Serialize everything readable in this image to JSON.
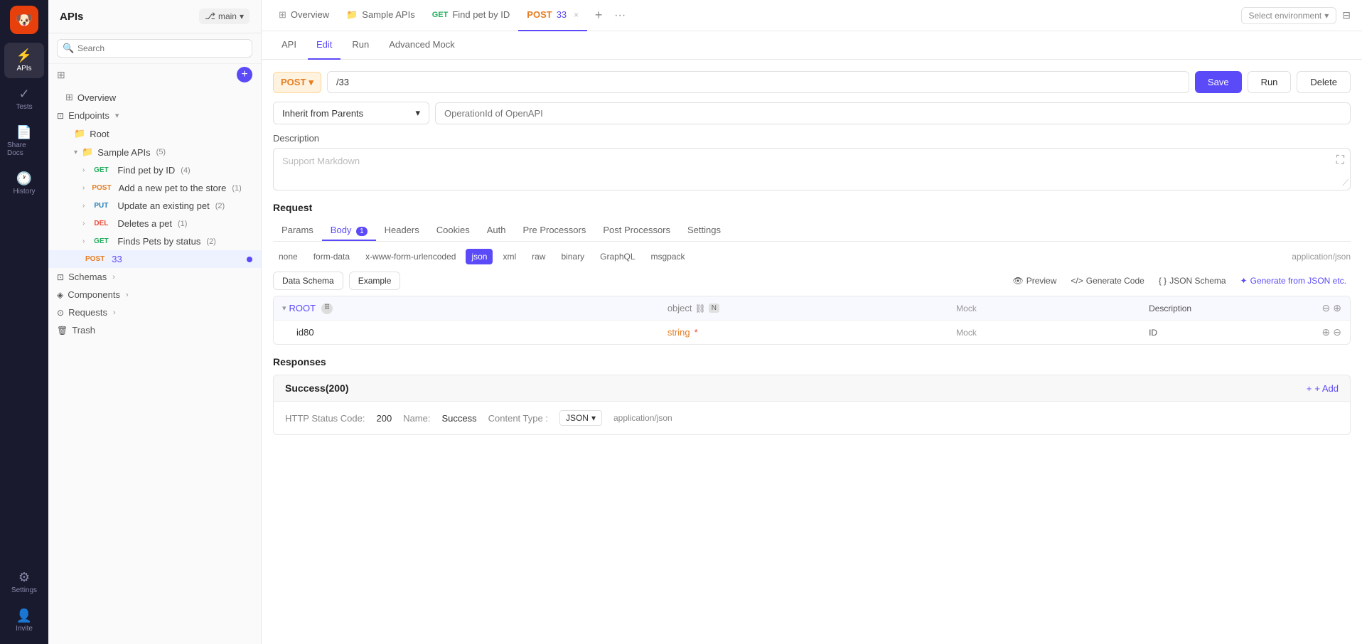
{
  "app": {
    "title": "APIs",
    "branch": "main"
  },
  "iconBar": {
    "items": [
      {
        "id": "apis",
        "label": "APIs",
        "icon": "⚡",
        "active": true
      },
      {
        "id": "tests",
        "label": "Tests",
        "icon": "🧪",
        "active": false
      },
      {
        "id": "share-docs",
        "label": "Share Docs",
        "icon": "📄",
        "active": false
      },
      {
        "id": "history",
        "label": "History",
        "icon": "🕐",
        "active": false
      },
      {
        "id": "settings",
        "label": "Settings",
        "icon": "⚙️",
        "active": false
      },
      {
        "id": "invite",
        "label": "Invite",
        "icon": "👤",
        "active": false
      }
    ]
  },
  "sidebar": {
    "search_placeholder": "Search",
    "items": [
      {
        "id": "overview",
        "label": "Overview",
        "type": "overview",
        "depth": 0
      },
      {
        "id": "endpoints",
        "label": "Endpoints",
        "type": "section",
        "depth": 0
      },
      {
        "id": "root",
        "label": "Root",
        "type": "folder",
        "depth": 1
      },
      {
        "id": "sample-apis",
        "label": "Sample APIs",
        "count": "(5)",
        "type": "folder-expanded",
        "depth": 1
      },
      {
        "id": "find-pet",
        "label": "Find pet by ID",
        "method": "GET",
        "count": "(4)",
        "type": "endpoint",
        "depth": 2
      },
      {
        "id": "add-pet",
        "label": "Add a new pet to the store",
        "method": "POST",
        "count": "(1)",
        "type": "endpoint",
        "depth": 2
      },
      {
        "id": "update-pet",
        "label": "Update an existing pet",
        "method": "PUT",
        "count": "(2)",
        "type": "endpoint",
        "depth": 2
      },
      {
        "id": "delete-pet",
        "label": "Deletes a pet",
        "method": "DEL",
        "count": "(1)",
        "type": "endpoint",
        "depth": 2
      },
      {
        "id": "finds-pets",
        "label": "Finds Pets by status",
        "method": "GET",
        "count": "(2)",
        "type": "endpoint",
        "depth": 2
      },
      {
        "id": "post33",
        "label": "33",
        "method": "POST",
        "type": "endpoint",
        "depth": 2,
        "active": true
      },
      {
        "id": "schemas",
        "label": "Schemas",
        "type": "section",
        "depth": 0
      },
      {
        "id": "components",
        "label": "Components",
        "type": "section",
        "depth": 0
      },
      {
        "id": "requests",
        "label": "Requests",
        "type": "section",
        "depth": 0
      },
      {
        "id": "trash",
        "label": "Trash",
        "type": "section",
        "depth": 0
      }
    ]
  },
  "topTabs": {
    "items": [
      {
        "id": "overview",
        "label": "Overview",
        "icon": "⊞",
        "active": false
      },
      {
        "id": "sample-apis",
        "label": "Sample APIs",
        "icon": "📁",
        "active": false
      },
      {
        "id": "find-pet-get",
        "label": "Find pet by ID",
        "method": "GET",
        "active": false
      },
      {
        "id": "post33",
        "label": "33",
        "method": "POST",
        "active": true
      }
    ],
    "env_placeholder": "Select environment"
  },
  "subTabs": {
    "items": [
      {
        "id": "api",
        "label": "API",
        "active": false
      },
      {
        "id": "edit",
        "label": "Edit",
        "active": true
      },
      {
        "id": "run",
        "label": "Run",
        "active": false
      },
      {
        "id": "advanced-mock",
        "label": "Advanced Mock",
        "active": false
      }
    ]
  },
  "editor": {
    "method": "POST",
    "path": "/33",
    "save_label": "Save",
    "run_label": "Run",
    "delete_label": "Delete",
    "inherit_label": "Inherit from Parents",
    "operation_placeholder": "OperationId of OpenAPI",
    "description_label": "Description",
    "description_placeholder": "Support Markdown"
  },
  "request": {
    "section_title": "Request",
    "tabs": [
      {
        "id": "params",
        "label": "Params",
        "badge": null
      },
      {
        "id": "body",
        "label": "Body",
        "badge": "1",
        "active": true
      },
      {
        "id": "headers",
        "label": "Headers"
      },
      {
        "id": "cookies",
        "label": "Cookies"
      },
      {
        "id": "auth",
        "label": "Auth"
      },
      {
        "id": "pre-processors",
        "label": "Pre Processors"
      },
      {
        "id": "post-processors",
        "label": "Post Processors"
      },
      {
        "id": "settings",
        "label": "Settings"
      }
    ],
    "body_types": [
      {
        "id": "none",
        "label": "none"
      },
      {
        "id": "form-data",
        "label": "form-data"
      },
      {
        "id": "x-www-form-urlencoded",
        "label": "x-www-form-urlencoded"
      },
      {
        "id": "json",
        "label": "json",
        "active": true
      },
      {
        "id": "xml",
        "label": "xml"
      },
      {
        "id": "raw",
        "label": "raw"
      },
      {
        "id": "binary",
        "label": "binary"
      },
      {
        "id": "graphql",
        "label": "GraphQL"
      },
      {
        "id": "msgpack",
        "label": "msgpack"
      }
    ],
    "content_type": "application/json",
    "schema_tabs": [
      {
        "id": "data-schema",
        "label": "Data Schema",
        "active": true
      },
      {
        "id": "example",
        "label": "Example"
      }
    ],
    "schema_actions": [
      {
        "id": "preview",
        "label": "Preview",
        "icon": "👁"
      },
      {
        "id": "generate-code",
        "label": "Generate Code",
        "icon": "<>"
      },
      {
        "id": "json-schema",
        "label": "JSON Schema",
        "icon": "{}"
      },
      {
        "id": "generate-from-json",
        "label": "Generate from JSON etc.",
        "icon": "✦"
      }
    ],
    "schema_fields": [
      {
        "id": "root",
        "name": "ROOT",
        "type": "object",
        "required": false,
        "n_badge": true,
        "mock": "Mock",
        "description": "Description",
        "is_root": true
      },
      {
        "id": "id80",
        "name": "id80",
        "type": "string",
        "required": true,
        "mock": "Mock",
        "description": "ID"
      }
    ]
  },
  "responses": {
    "section_title": "Responses",
    "items": [
      {
        "id": "success-200",
        "label": "Success(200)",
        "status_code": "200",
        "status_code_label": "HTTP Status Code:",
        "name_label": "Name:",
        "name_value": "Success",
        "content_type_label": "Content Type :",
        "content_type_value": "JSON",
        "content_type_detail": "application/json"
      }
    ],
    "add_label": "+ Add"
  }
}
